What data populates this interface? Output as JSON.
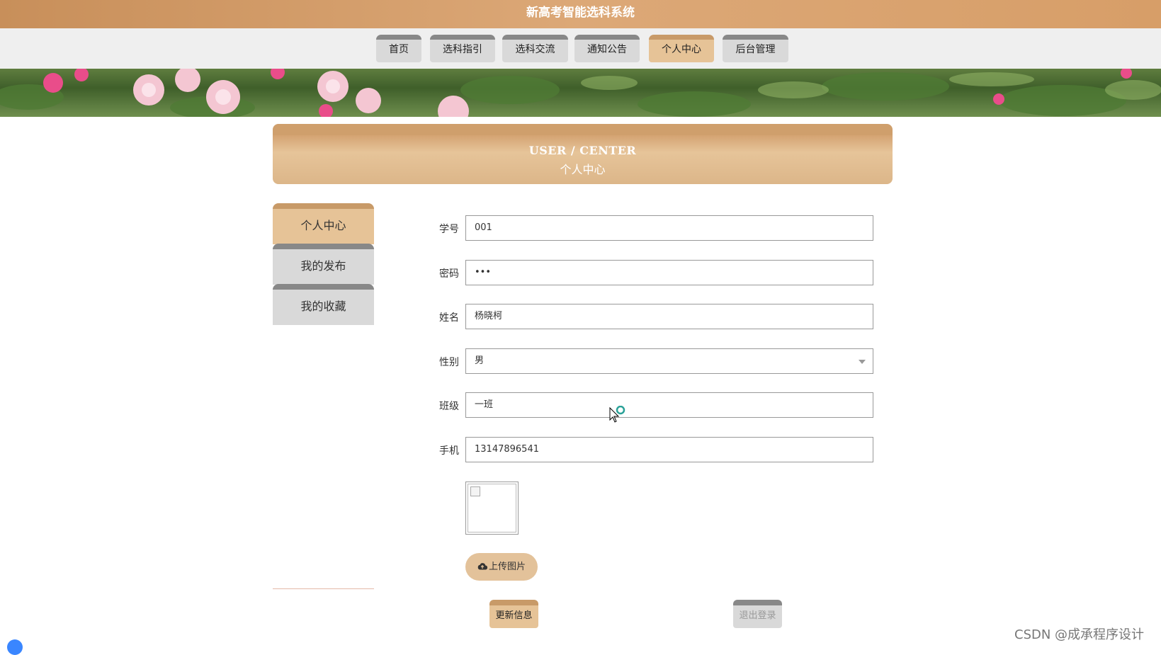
{
  "app": {
    "title": "新高考智能选科系统"
  },
  "nav": {
    "items": [
      {
        "label": "首页"
      },
      {
        "label": "选科指引"
      },
      {
        "label": "选科交流"
      },
      {
        "label": "通知公告"
      },
      {
        "label": "个人中心"
      },
      {
        "label": "后台管理"
      }
    ],
    "active": "个人中心"
  },
  "header": {
    "title_en": "USER / CENTER",
    "title_cn": "个人中心"
  },
  "sidebar": {
    "items": [
      {
        "label": "个人中心"
      },
      {
        "label": "我的发布"
      },
      {
        "label": "我的收藏"
      }
    ],
    "active": "个人中心"
  },
  "form": {
    "student_id": {
      "label": "学号",
      "value": "001"
    },
    "password": {
      "label": "密码",
      "value": "•••"
    },
    "name": {
      "label": "姓名",
      "value": "杨晓柯"
    },
    "gender": {
      "label": "性别",
      "value": "男"
    },
    "class": {
      "label": "班级",
      "value": "一班"
    },
    "phone": {
      "label": "手机",
      "value": "13147896541"
    },
    "upload_label": "上传图片",
    "update_label": "更新信息",
    "logout_label": "退出登录"
  },
  "colors": {
    "accent": "#d9a878",
    "accent_dark": "#c89a68",
    "tab_inactive": "#d9d9d9"
  },
  "icons": {
    "upload": "cloud-upload-icon",
    "select": "chevron-down-icon"
  },
  "watermark": "CSDN @成承程序设计"
}
